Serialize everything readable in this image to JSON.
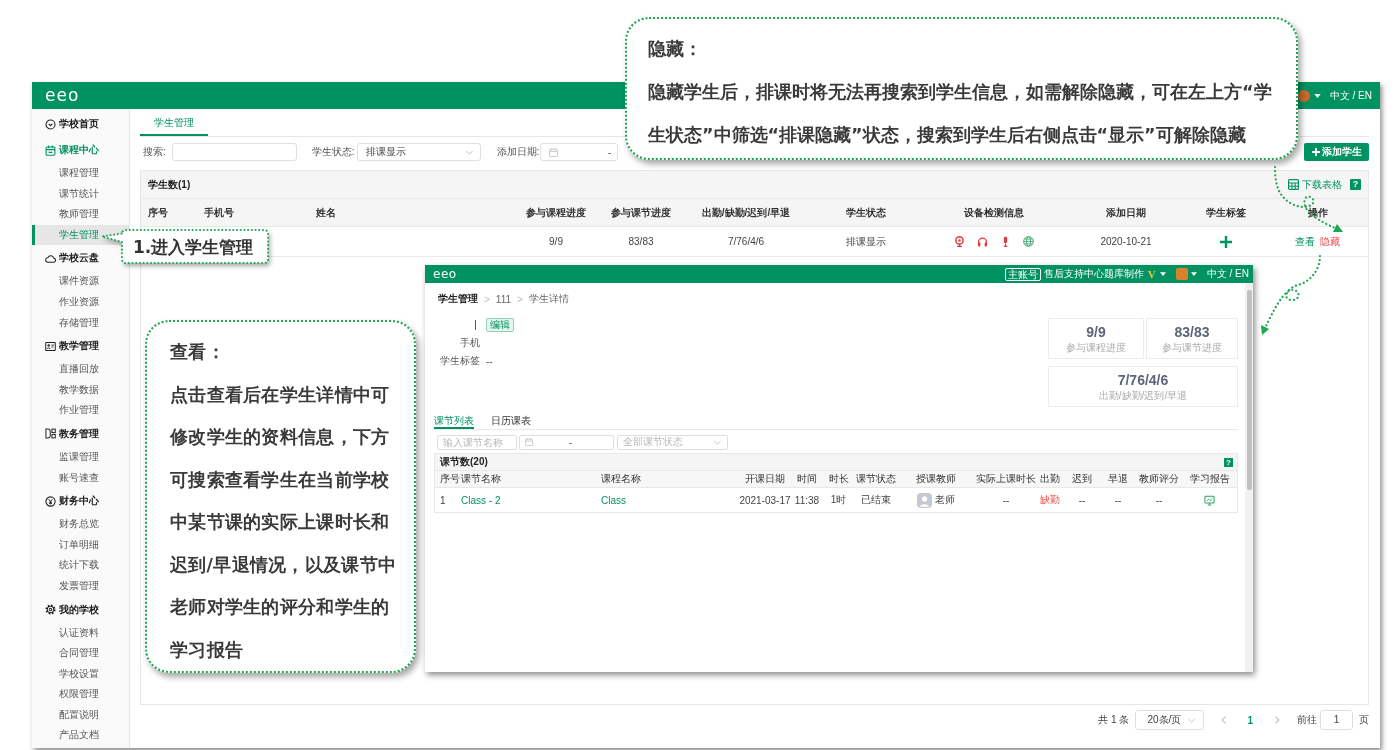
{
  "app_header": {
    "logo": "eeo",
    "language": "中文 / EN"
  },
  "sidebar": {
    "groups": [
      {
        "label": "学校首页",
        "selected": false
      },
      {
        "label": "课程中心",
        "selected": true,
        "children": [
          {
            "label": "课程管理",
            "selected": false
          },
          {
            "label": "课节统计",
            "selected": false
          },
          {
            "label": "教师管理",
            "selected": false
          },
          {
            "label": "学生管理",
            "selected": true
          }
        ]
      },
      {
        "label": "学校云盘",
        "selected": false,
        "children": [
          {
            "label": "课件资源",
            "selected": false
          },
          {
            "label": "作业资源",
            "selected": false
          },
          {
            "label": "存储管理",
            "selected": false
          }
        ]
      },
      {
        "label": "教学管理",
        "selected": false,
        "children": [
          {
            "label": "直播回放",
            "selected": false
          },
          {
            "label": "教学数据",
            "selected": false
          },
          {
            "label": "作业管理",
            "selected": false
          }
        ]
      },
      {
        "label": "教务管理",
        "selected": false,
        "children": [
          {
            "label": "监课管理",
            "selected": false
          },
          {
            "label": "账号速查",
            "selected": false
          }
        ]
      },
      {
        "label": "财务中心",
        "selected": false,
        "children": [
          {
            "label": "财务总览",
            "selected": false
          },
          {
            "label": "订单明细",
            "selected": false
          },
          {
            "label": "统计下载",
            "selected": false
          },
          {
            "label": "发票管理",
            "selected": false
          }
        ]
      },
      {
        "label": "我的学校",
        "selected": false,
        "children": [
          {
            "label": "认证资料",
            "selected": false
          },
          {
            "label": "合同管理",
            "selected": false
          },
          {
            "label": "学校设置",
            "selected": false
          },
          {
            "label": "权限管理",
            "selected": false
          },
          {
            "label": "配置说明",
            "selected": false
          },
          {
            "label": "产品文档",
            "selected": false
          }
        ]
      }
    ]
  },
  "page_tabs": [
    {
      "label": "学生管理",
      "selected": true
    }
  ],
  "filters": {
    "search": {
      "label": "搜索:"
    },
    "status": {
      "label": "学生状态:",
      "value": "排课显示"
    },
    "date": {
      "label": "添加日期:",
      "separator": "-"
    }
  },
  "add_button": {
    "label": "添加学生"
  },
  "student_table": {
    "title": "学生数(1)",
    "download": "下载表格",
    "help": "?",
    "columns": [
      "序号",
      "手机号",
      "姓名",
      "参与课程进度",
      "参与课节进度",
      "出勤/缺勤/迟到/早退",
      "学生状态",
      "设备检测信息",
      "添加日期",
      "学生标签",
      "操作"
    ],
    "rows": [
      {
        "cells": [
          {
            "kind": "text",
            "text": ""
          },
          {
            "kind": "text",
            "text": ""
          },
          {
            "kind": "text",
            "text": ""
          },
          {
            "kind": "text",
            "text": "9/9"
          },
          {
            "kind": "text",
            "text": "83/83"
          },
          {
            "kind": "text",
            "text": "7/76/4/6"
          },
          {
            "kind": "text",
            "text": "排课显示"
          },
          {
            "kind": "devices",
            "devices": [
              {
                "kind": "camera",
                "ok": false
              },
              {
                "kind": "headphones",
                "ok": false
              },
              {
                "kind": "microphone",
                "ok": false
              },
              {
                "kind": "network",
                "ok": true
              }
            ]
          },
          {
            "kind": "text",
            "text": "2020-10-21"
          },
          {
            "kind": "tag-add"
          },
          {
            "kind": "actions",
            "actions": [
              {
                "kind": "view",
                "label": "查看"
              },
              {
                "kind": "hide",
                "label": "隐藏"
              }
            ]
          }
        ]
      }
    ]
  },
  "pagination": {
    "total": "共 1 条",
    "page_size": "20条/页",
    "pages": [
      {
        "label": "1",
        "selected": true
      }
    ],
    "goto_label": "前往",
    "goto_value": "1",
    "goto_suffix": "页"
  },
  "detail_screenshot": {
    "header": {
      "logo": "eeo",
      "account_badge": "主账号",
      "account_name": "售后支持中心题库制作",
      "vip_badge": "V",
      "language": "中文 / EN"
    },
    "breadcrumb": {
      "items": [
        "学生管理",
        "111",
        "学生详情"
      ],
      "separator": ">"
    },
    "profile": {
      "edit_button": "编辑",
      "phone_label": "手机",
      "tags_label": "学生标签",
      "tags_value": "--"
    },
    "stats": [
      {
        "value": "9/9",
        "label": "参与课程进度"
      },
      {
        "value": "83/83",
        "label": "参与课节进度"
      },
      {
        "value": "7/76/4/6",
        "label": "出勤/缺勤/迟到/早退"
      }
    ],
    "tabs": [
      {
        "label": "课节列表",
        "selected": true
      },
      {
        "label": "日历课表",
        "selected": false
      }
    ],
    "filters": {
      "name_field": {
        "placeholder": "输入课节名称"
      },
      "date_field": {
        "separator": "-"
      },
      "status_select": {
        "placeholder": "全部课节状态"
      }
    },
    "lesson_table": {
      "title": "课节数(20)",
      "help": "?",
      "columns": [
        "序号",
        "课节名称",
        "课程名称",
        "开课日期",
        "时间",
        "时长",
        "课节状态",
        "授课教师",
        "实际上课时长",
        "出勤",
        "迟到",
        "早退",
        "教师评分",
        "学习报告"
      ],
      "rows": [
        {
          "cells": [
            {
              "kind": "text",
              "text": "1"
            },
            {
              "kind": "link",
              "text": "Class - 2"
            },
            {
              "kind": "link",
              "text": "Class"
            },
            {
              "kind": "text",
              "text": "2021-03-17"
            },
            {
              "kind": "text",
              "text": "11:38"
            },
            {
              "kind": "text",
              "text": "1时"
            },
            {
              "kind": "text",
              "text": "已结束"
            },
            {
              "kind": "teacher",
              "text": "老师"
            },
            {
              "kind": "text",
              "text": "--"
            },
            {
              "kind": "alert",
              "text": "缺勤"
            },
            {
              "kind": "text",
              "text": "--"
            },
            {
              "kind": "text",
              "text": "--"
            },
            {
              "kind": "text",
              "text": "--"
            },
            {
              "kind": "report"
            }
          ]
        }
      ]
    }
  },
  "callouts": [
    {
      "kind": "step",
      "text": "1.进入学生管理"
    },
    {
      "kind": "note",
      "title": "隐藏：",
      "text": "隐藏学生后，排课时将无法再搜索到学生信息，如需解除隐藏，可在左上方“学生状态”中筛选“排课隐藏”状态，搜索到学生后右侧点击“显示”可解除隐藏"
    },
    {
      "kind": "note",
      "title": "查看：",
      "text": "点击查看后在学生详情中可修改学生的资料信息，下方可搜索查看学生在当前学校中某节课的实际上课时长和迟到/早退情况，以及课节中老师对学生的评分和学生的学习报告"
    }
  ]
}
